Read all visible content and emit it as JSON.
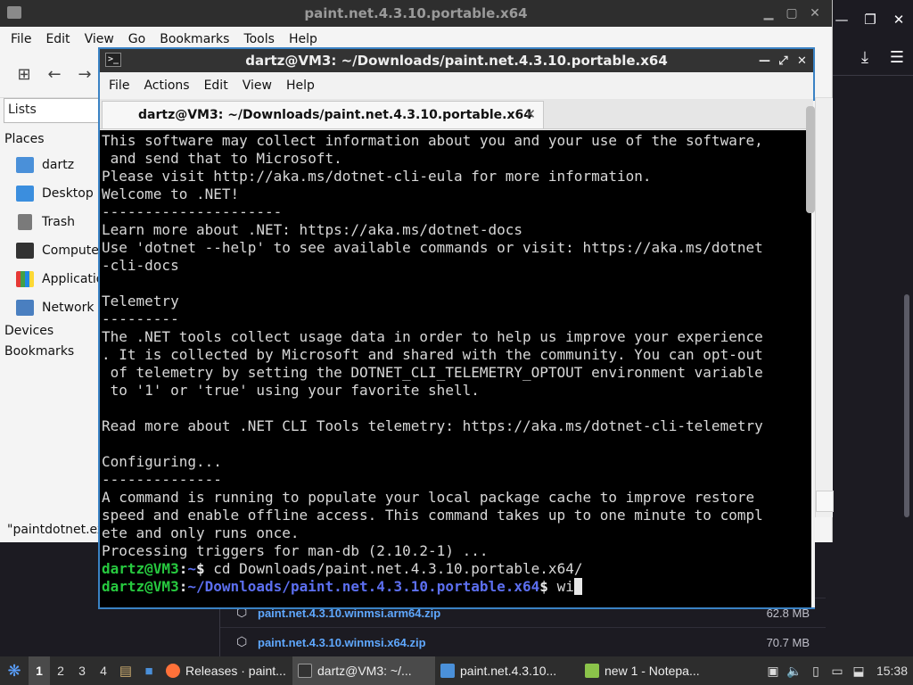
{
  "browser": {
    "assets": [
      {
        "name": "paint.net.4.3.10.winmsi.arm64.zip",
        "size": "62.8 MB"
      },
      {
        "name": "paint.net.4.3.10.winmsi.x64.zip",
        "size": "70.7 MB"
      }
    ]
  },
  "file_manager": {
    "title": "paint.net.4.3.10.portable.x64",
    "menu": [
      "File",
      "Edit",
      "View",
      "Go",
      "Bookmarks",
      "Tools",
      "Help"
    ],
    "lists_label": "Lists",
    "places_label": "Places",
    "places": [
      "dartz",
      "Desktop",
      "Trash",
      "Computer",
      "Applications",
      "Network"
    ],
    "devices_label": "Devices",
    "bookmarks_label": "Bookmarks",
    "status": "\"paintdotnet.exe\""
  },
  "terminal": {
    "title": "dartz@VM3: ~/Downloads/paint.net.4.3.10.portable.x64",
    "menu": [
      "File",
      "Actions",
      "Edit",
      "View",
      "Help"
    ],
    "tab_label": "dartz@VM3: ~/Downloads/paint.net.4.3.10.portable.x64",
    "output_lines": [
      "This software may collect information about you and your use of the software,",
      " and send that to Microsoft.",
      "Please visit http://aka.ms/dotnet-cli-eula for more information.",
      "Welcome to .NET!",
      "---------------------",
      "Learn more about .NET: https://aka.ms/dotnet-docs",
      "Use 'dotnet --help' to see available commands or visit: https://aka.ms/dotnet",
      "-cli-docs",
      "",
      "Telemetry",
      "---------",
      "The .NET tools collect usage data in order to help us improve your experience",
      ". It is collected by Microsoft and shared with the community. You can opt-out",
      " of telemetry by setting the DOTNET_CLI_TELEMETRY_OPTOUT environment variable",
      " to '1' or 'true' using your favorite shell.",
      "",
      "Read more about .NET CLI Tools telemetry: https://aka.ms/dotnet-cli-telemetry",
      "",
      "Configuring...",
      "--------------",
      "A command is running to populate your local package cache to improve restore",
      "speed and enable offline access. This command takes up to one minute to compl",
      "ete and only runs once.",
      "Processing triggers for man-db (2.10.2-1) ..."
    ],
    "prompt1": {
      "user": "dartz@VM3",
      "sep": ":",
      "path": "~",
      "sym": "$ ",
      "cmd": "cd Downloads/paint.net.4.3.10.portable.x64/"
    },
    "prompt2": {
      "user": "dartz@VM3",
      "sep": ":",
      "path": "~/Downloads/paint.net.4.3.10.portable.x64",
      "sym": "$ ",
      "cmd": "wi"
    }
  },
  "taskbar": {
    "workspaces": [
      "1",
      "2",
      "3",
      "4"
    ],
    "tasks": [
      {
        "label": "Releases · paint...",
        "color": "#ff7139"
      },
      {
        "label": "dartz@VM3: ~/...",
        "color": "#333333"
      },
      {
        "label": "paint.net.4.3.10...",
        "color": "#4a90d9"
      },
      {
        "label": "new 1 - Notepa...",
        "color": "#8bc34a"
      }
    ],
    "clock": "15:38"
  },
  "colors": {
    "prompt_user": "#27c93f",
    "prompt_path": "#5c6ff0",
    "window_border": "#3a82c4",
    "link": "#5fa8ff"
  }
}
